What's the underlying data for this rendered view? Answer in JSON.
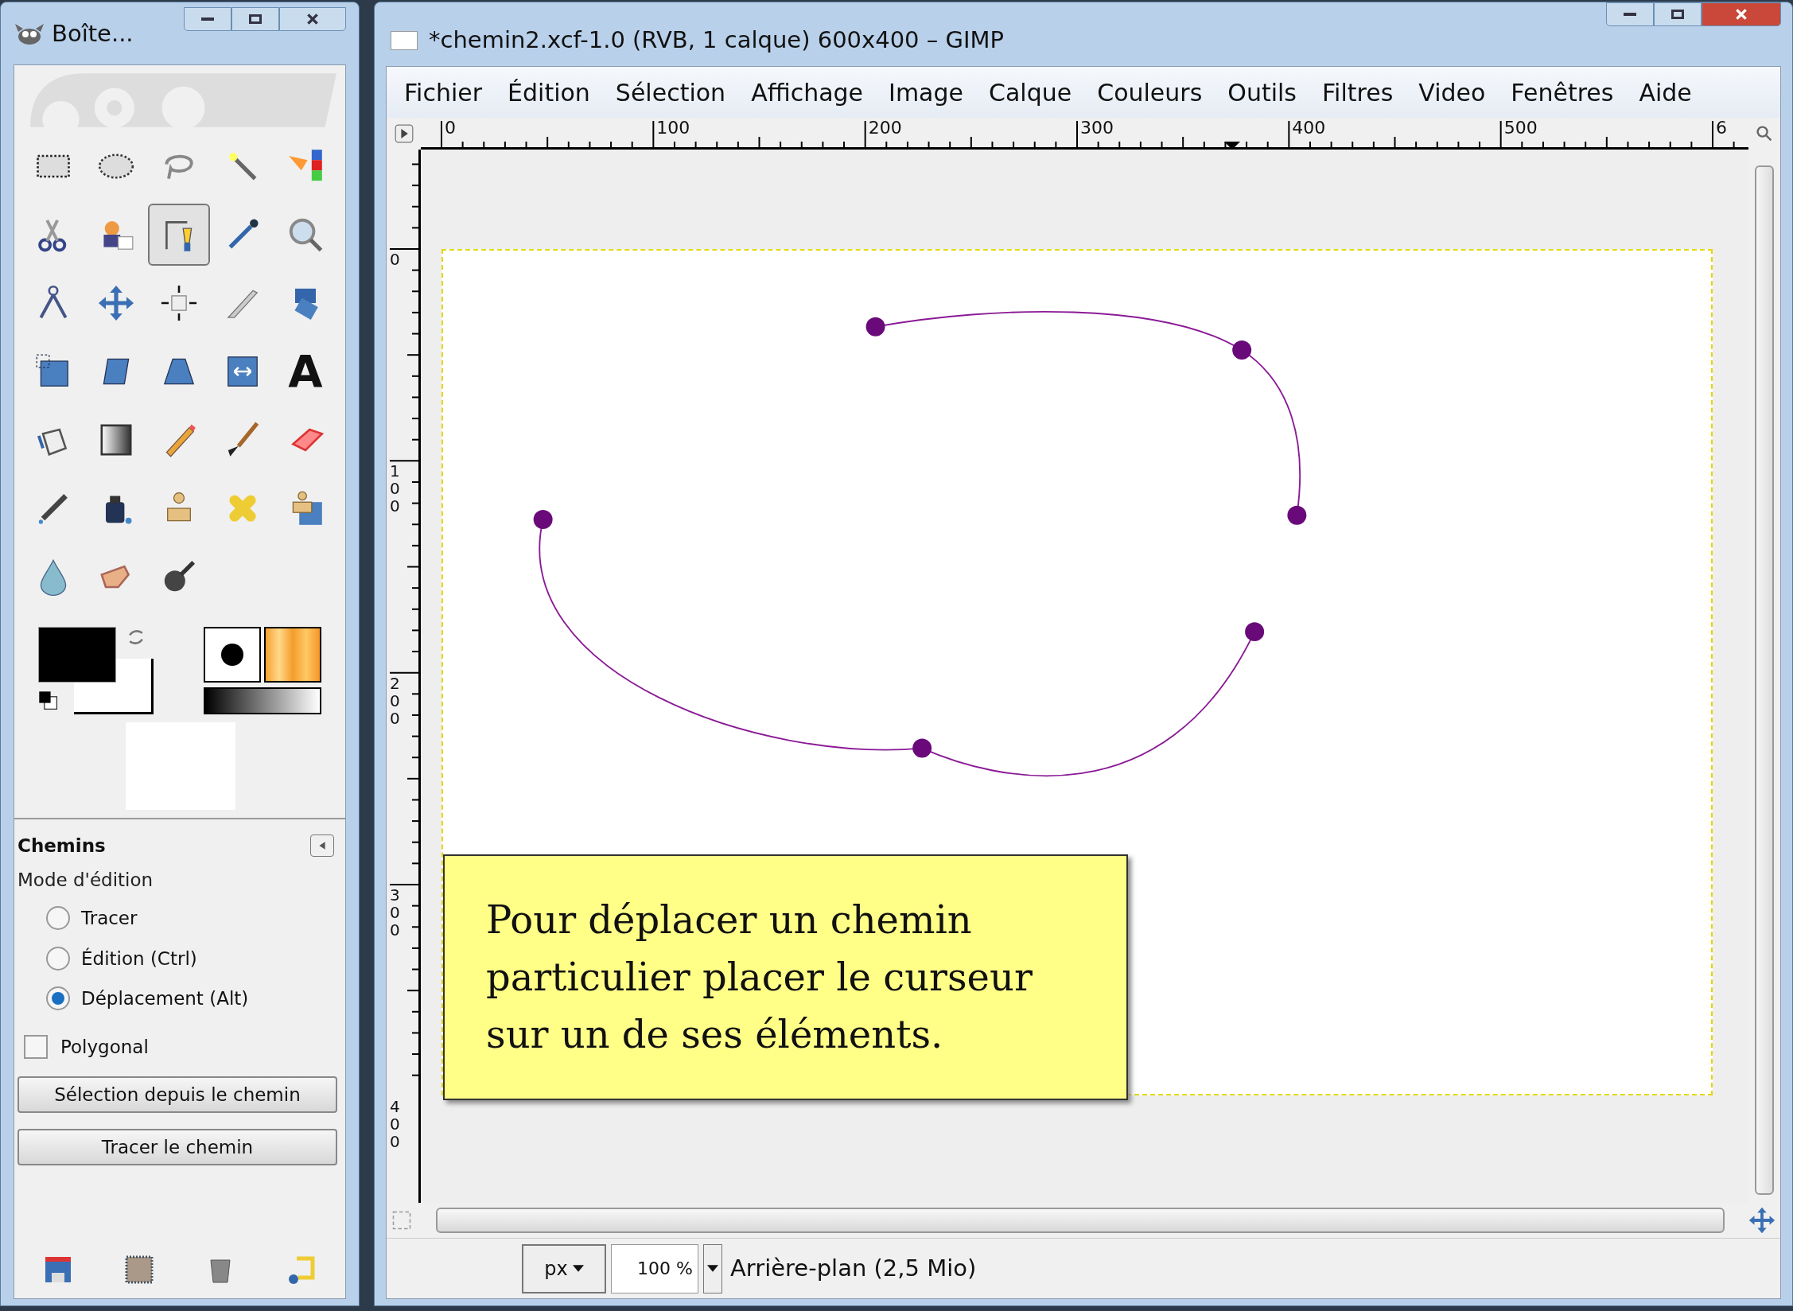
{
  "toolbox": {
    "title": "Boîte...",
    "tools": [
      {
        "selected": false
      },
      {
        "selected": false
      },
      {
        "selected": false
      },
      {
        "selected": false
      },
      {
        "selected": false
      },
      {
        "selected": false
      },
      {
        "selected": false
      },
      {
        "selected": true
      },
      {
        "selected": false
      },
      {
        "selected": false
      },
      {
        "selected": false
      },
      {
        "selected": false
      },
      {
        "selected": false
      },
      {
        "selected": false
      },
      {
        "selected": false
      },
      {
        "selected": false
      },
      {
        "selected": false
      },
      {
        "selected": false
      },
      {
        "selected": false
      },
      {
        "selected": false,
        "glyph": "A"
      },
      {
        "selected": false
      },
      {
        "selected": false
      },
      {
        "selected": false
      },
      {
        "selected": false
      },
      {
        "selected": false
      },
      {
        "selected": false
      },
      {
        "selected": false
      },
      {
        "selected": false
      },
      {
        "selected": false
      },
      {
        "selected": false
      },
      {
        "selected": false
      },
      {
        "selected": false
      },
      {
        "selected": false
      }
    ],
    "tool_options": {
      "title": "Chemins",
      "mode_label": "Mode d'édition",
      "modes": [
        {
          "label": "Tracer",
          "selected": false
        },
        {
          "label": "Édition (Ctrl)",
          "selected": false
        },
        {
          "label": "Déplacement (Alt)",
          "selected": true
        }
      ],
      "polygonal": {
        "label": "Polygonal",
        "checked": false
      },
      "buttons": [
        "Sélection depuis le chemin",
        "Tracer le chemin"
      ]
    }
  },
  "image_window": {
    "title": "*chemin2.xcf-1.0 (RVB, 1 calque) 600x400 – GIMP",
    "menu": [
      "Fichier",
      "Édition",
      "Sélection",
      "Affichage",
      "Image",
      "Calque",
      "Couleurs",
      "Outils",
      "Filtres",
      "Video",
      "Fenêtres",
      "Aide"
    ],
    "ruler_h": [
      "0",
      "100",
      "200",
      "300",
      "400",
      "500",
      "6"
    ],
    "ruler_v": [
      "0",
      "100",
      "200",
      "300",
      "400"
    ],
    "note": "Pour déplacer un chemin particulier placer le curseur sur un de ses éléments.",
    "status": {
      "unit": "px",
      "zoom": "100 %",
      "layer": "Arrière-plan (2,5 Mio)"
    }
  }
}
